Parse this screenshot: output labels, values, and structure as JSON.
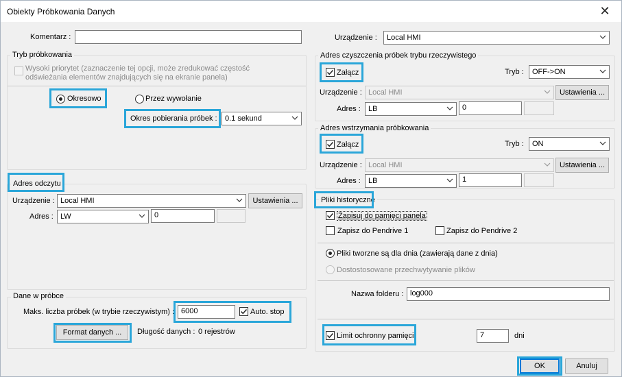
{
  "window": {
    "title": "Obiekty Próbkowania Danych",
    "close_glyph": "✕"
  },
  "top": {
    "comment_label": "Komentarz :",
    "comment_value": "",
    "device_label": "Urządzenie :",
    "device_value": "Local HMI"
  },
  "sampling_mode": {
    "group_title": "Tryb próbkowania",
    "high_priority_label": "Wysoki priorytet (zaznaczenie tej opcji, może zredukować częstość odświeżania elementów znajdujących się na ekranie panela)",
    "periodic_label": "Okresowo",
    "on_call_label": "Przez wywołanie",
    "period_label": "Okres pobierania próbek :",
    "period_value": "0.1 sekund",
    "selected": "periodic"
  },
  "read_address": {
    "group_title": "Adres odczytu",
    "device_label": "Urządzenie :",
    "device_value": "Local HMI",
    "settings_label": "Ustawienia ...",
    "address_label": "Adres :",
    "address_type": "LW",
    "address_value": "0",
    "address_extra": ""
  },
  "sample_data": {
    "group_title": "Dane w próbce",
    "max_label": "Maks. liczba próbek (w trybie rzeczywistym) :",
    "max_value": "6000",
    "auto_stop_label": "Auto. stop",
    "auto_stop_checked": true,
    "format_button": "Format danych ...",
    "data_length_label": "Długość danych :",
    "data_length_value": "0 rejestrów"
  },
  "clear_address": {
    "group_title": "Adres czyszczenia próbek trybu rzeczywistego",
    "enable_label": "Załącz",
    "enable_checked": true,
    "mode_label": "Tryb :",
    "mode_value": "OFF->ON",
    "device_label": "Urządzenie :",
    "device_value": "Local HMI",
    "settings_label": "Ustawienia ...",
    "address_label": "Adres :",
    "address_type": "LB",
    "address_value": "0",
    "address_extra": ""
  },
  "hold_address": {
    "group_title": "Adres wstrzymania próbkowania",
    "enable_label": "Załącz",
    "enable_checked": true,
    "mode_label": "Tryb :",
    "mode_value": "ON",
    "device_label": "Urządzenie :",
    "device_value": "Local HMI",
    "settings_label": "Ustawienia ...",
    "address_label": "Adres :",
    "address_type": "LB",
    "address_value": "1",
    "address_extra": ""
  },
  "history_files": {
    "group_title": "Pliki historyczne",
    "save_panel_label": "Zapisuj do pamięci panela",
    "save_panel_checked": true,
    "pendrive1_label": "Zapisz do Pendrive 1",
    "pendrive1_checked": false,
    "pendrive2_label": "Zapisz do Pendrive 2",
    "pendrive2_checked": false,
    "daily_label": "Pliki tworzne są dla dnia (zawierają dane z dnia)",
    "custom_label": "Dostostosowane przechwytywanie plików",
    "selected": "daily",
    "folder_label": "Nazwa folderu :",
    "folder_value": "log000",
    "limit_label": "Limit ochronny pamięci",
    "limit_checked": true,
    "limit_value": "7",
    "limit_unit": "dni"
  },
  "footer": {
    "ok_label": "OK",
    "cancel_label": "Anuluj"
  },
  "colors": {
    "highlight": "#2aa6d9",
    "background": "#f0f0f0",
    "focus": "#0078d7"
  }
}
